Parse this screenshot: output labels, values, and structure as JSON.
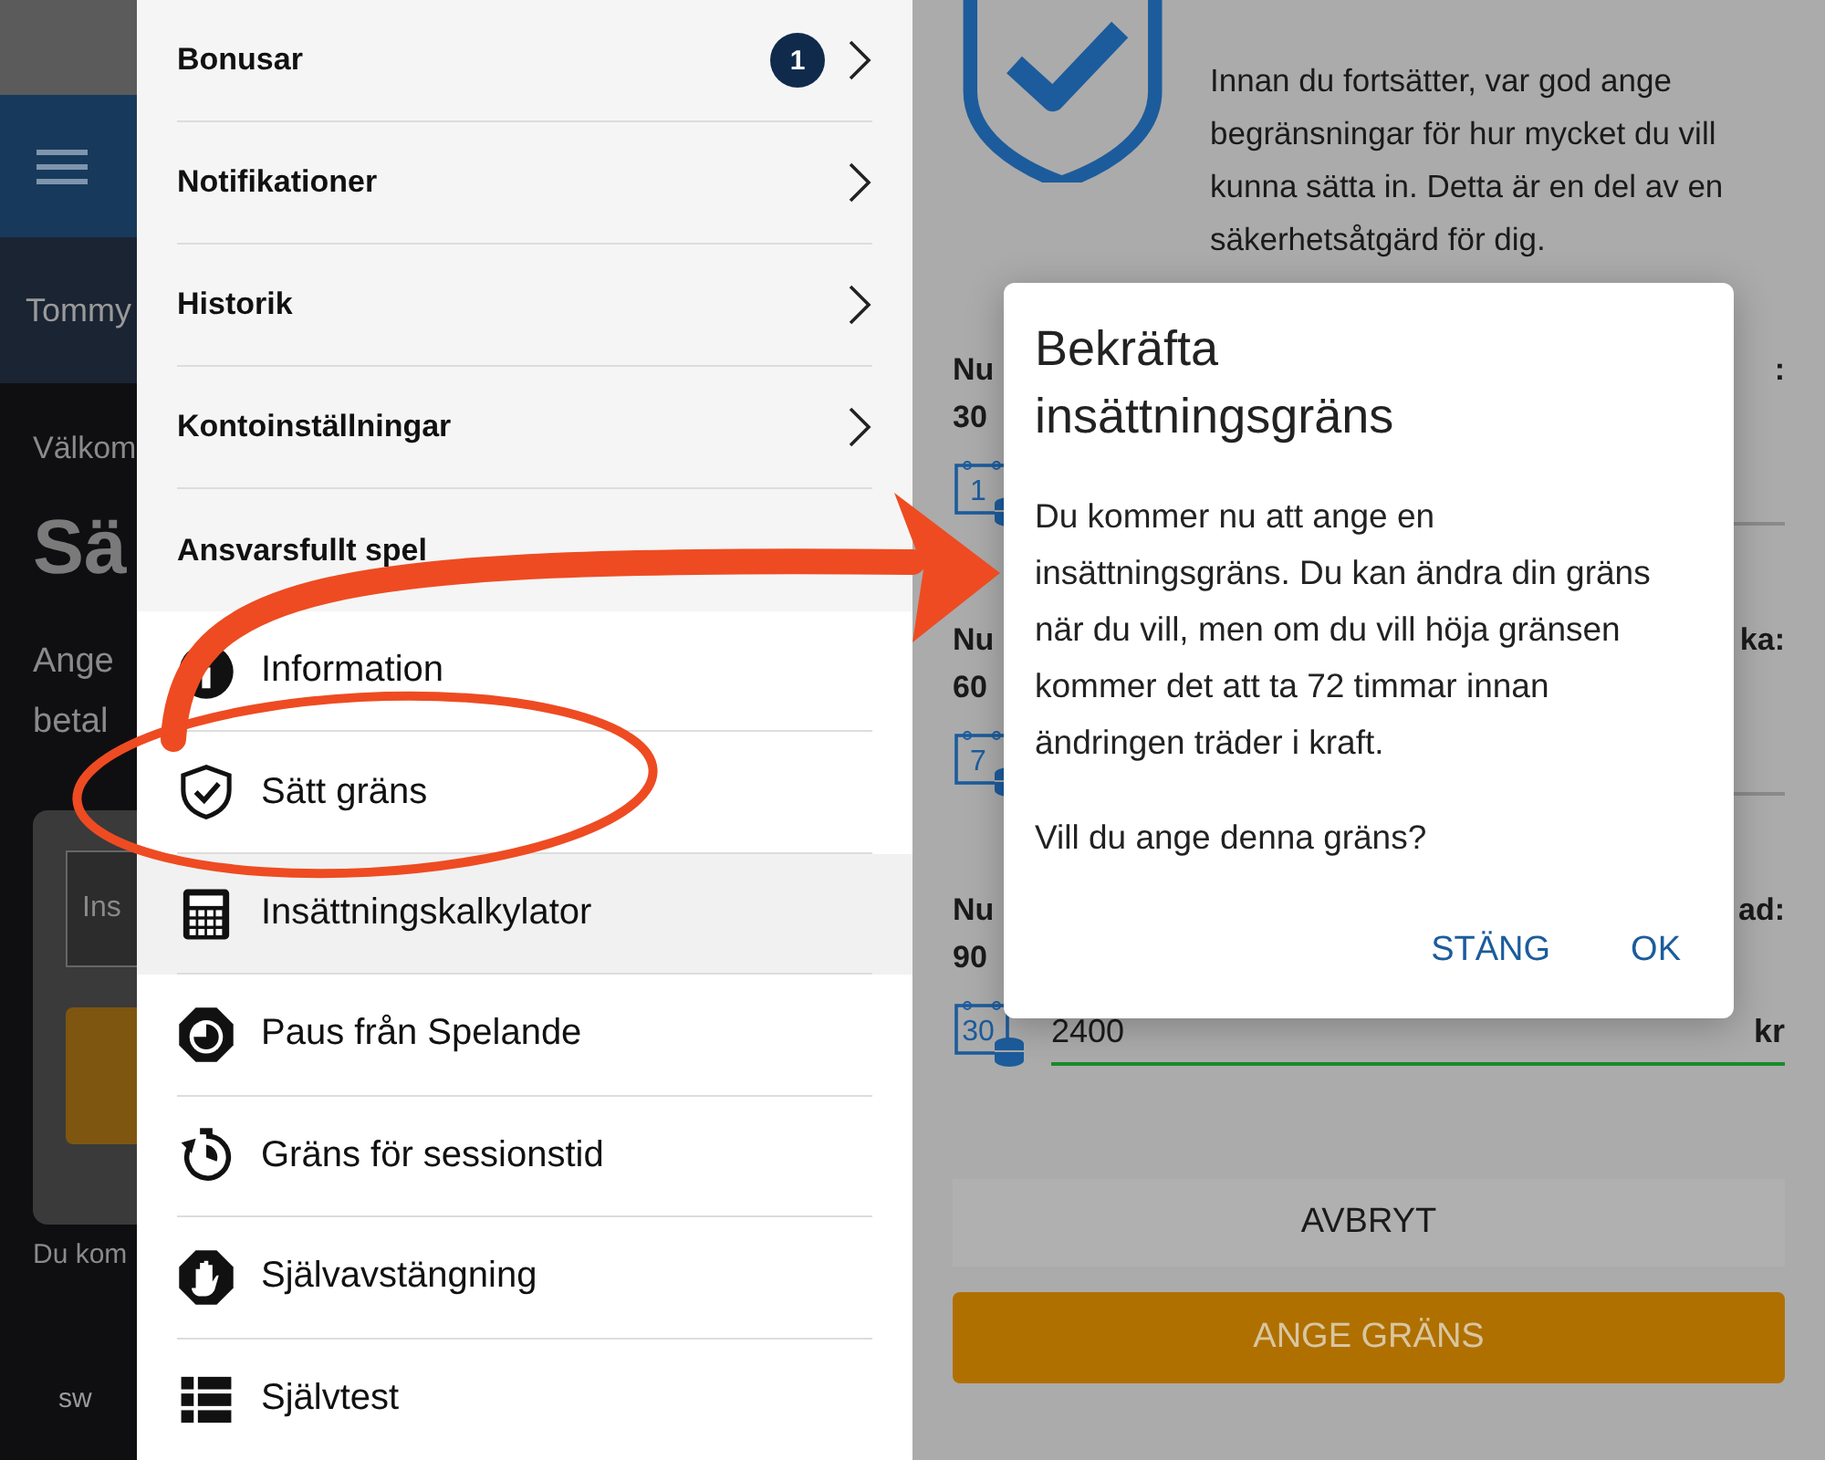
{
  "back_app": {
    "user": "Tommy",
    "welcome": "Välkom",
    "heading": "Sä",
    "intro_lines": [
      "Ange",
      "betal"
    ],
    "field_placeholder": "Ins",
    "footer": "Du kom",
    "logo": "sw"
  },
  "menu": {
    "items": [
      {
        "label": "Bonusar",
        "badge": "1"
      },
      {
        "label": "Notifikationer"
      },
      {
        "label": "Historik"
      },
      {
        "label": "Kontoinställningar"
      }
    ],
    "section": "Ansvarsfullt spel",
    "tools": [
      {
        "label": "Information",
        "kind": "info",
        "selected": false
      },
      {
        "label": "Sätt gräns",
        "kind": "shield",
        "selected": false
      },
      {
        "label": "Insättningskalkylator",
        "kind": "calculator",
        "selected": true
      },
      {
        "label": "Paus från Spelande",
        "kind": "pause",
        "selected": false
      },
      {
        "label": "Gräns för sessionstid",
        "kind": "timer",
        "selected": false
      },
      {
        "label": "Självavstängning",
        "kind": "stop",
        "selected": false
      },
      {
        "label": "Självtest",
        "kind": "list",
        "selected": false
      }
    ]
  },
  "page": {
    "intro": "Innan du fortsätter, var god ange begränsningar för hur mycket du vill kunna sätta in. Detta är en del av en säkerhetsåtgärd för dig.",
    "limits": [
      {
        "label": "Nu",
        "value": "30",
        "label_end": ":",
        "day": "1"
      },
      {
        "label": "Nu",
        "value": "60",
        "label_end": "ka:",
        "day": "7"
      },
      {
        "label": "Nu",
        "value": "90",
        "label_end": "ad:",
        "day": "30",
        "amount": "2400",
        "currency": "kr"
      }
    ],
    "cancel": "AVBRYT",
    "submit": "ANGE GRÄNS"
  },
  "dialog": {
    "title": "Bekräfta insättningsgräns",
    "body": "Du kommer nu att ange en insättningsgräns. Du kan ändra din gräns när du vill, men om du vill höja gränsen kommer det att ta 72 timmar innan ändringen träder i kraft.",
    "question": "Vill du ange denna gräns?",
    "buttons": [
      "STÄNG",
      "OK"
    ]
  }
}
